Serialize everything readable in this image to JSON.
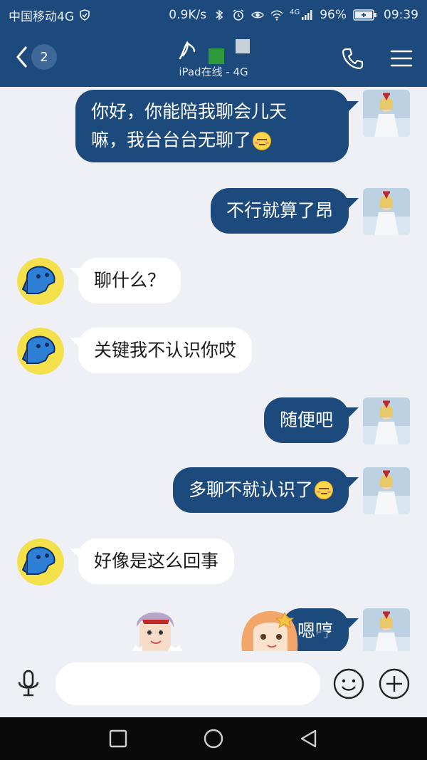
{
  "status_bar": {
    "carrier": "中国移动4G",
    "speed": "0.9K/s",
    "network_small": "4G",
    "battery": "96%",
    "time": "09:39"
  },
  "header": {
    "unread_count": "2",
    "contact_subtitle": "iPad在线 - 4G"
  },
  "messages": [
    {
      "side": "out",
      "text": "你好，你能陪我聊会儿天嘛，我台台台无聊了",
      "line1": "你好，你能陪我聊会儿天",
      "line2": "嘛，我台台台无聊了",
      "emoji": "embarrassed-emoji"
    },
    {
      "side": "out",
      "text": "不行就算了昂"
    },
    {
      "side": "in",
      "text": "聊什么？"
    },
    {
      "side": "in",
      "text": "关键我不认识你哎"
    },
    {
      "side": "out",
      "text": "随便吧"
    },
    {
      "side": "out",
      "text": "多聊不就认识了",
      "emoji": "embarrassed-emoji"
    },
    {
      "side": "in",
      "text": "好像是这么回事"
    },
    {
      "side": "out",
      "text": "嗯哼"
    }
  ],
  "input": {
    "value": "",
    "placeholder": ""
  },
  "icons": {
    "back": "chevron-left-icon",
    "call": "phone-icon",
    "menu": "menu-icon",
    "voice": "microphone-icon",
    "emoji": "smiley-icon",
    "plus": "plus-icon"
  },
  "colors": {
    "brand": "#1c4a7c",
    "background": "#eef0f5",
    "bubble_in": "#ffffff"
  }
}
